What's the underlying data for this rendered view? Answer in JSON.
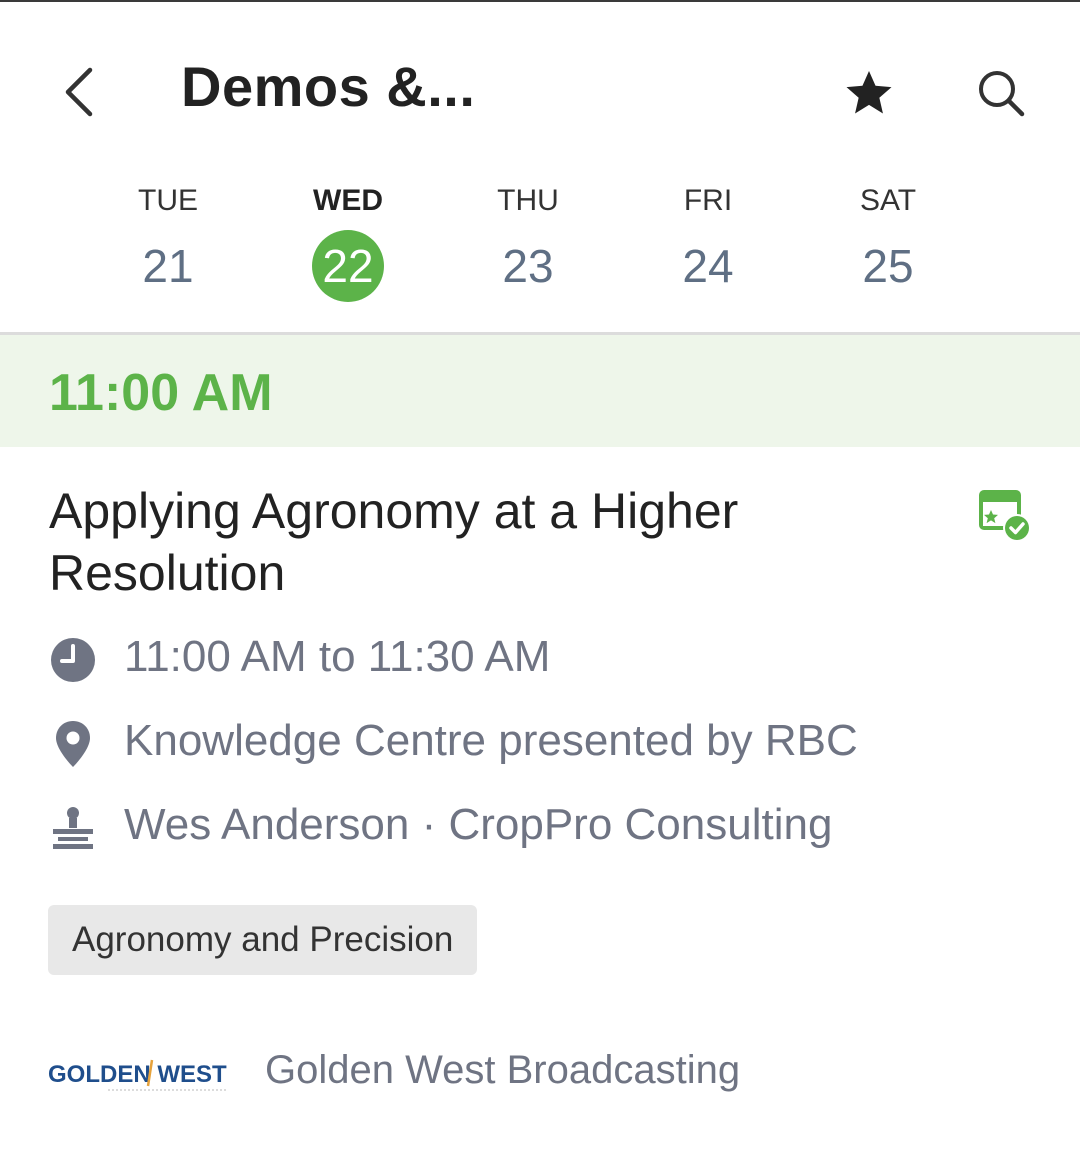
{
  "header": {
    "title": "Demos &...",
    "back_icon": "chevron-left-icon",
    "favorite_icon": "star-icon",
    "search_icon": "search-icon"
  },
  "days": [
    {
      "name": "TUE",
      "num": "21",
      "selected": false
    },
    {
      "name": "WED",
      "num": "22",
      "selected": true
    },
    {
      "name": "THU",
      "num": "23",
      "selected": false
    },
    {
      "name": "FRI",
      "num": "24",
      "selected": false
    },
    {
      "name": "SAT",
      "num": "25",
      "selected": false
    }
  ],
  "time_banner": {
    "label": "11:00 AM"
  },
  "session": {
    "title": "Applying Agronomy at a Higher Resolution",
    "calendar_icon": "calendar-added-icon",
    "time": "11:00 AM to 11:30 AM",
    "location": "Knowledge Centre presented by RBC",
    "speaker": "Wes Anderson · CropPro Consulting",
    "track": "Agronomy and Precision"
  },
  "sponsor": {
    "logo_text": "GOLDEN WEST",
    "name": "Golden West Broadcasting"
  },
  "colors": {
    "accent": "#5cb349",
    "banner_bg": "#eef6ea",
    "muted_text": "#6f7483",
    "day_number": "#5f6f84"
  }
}
